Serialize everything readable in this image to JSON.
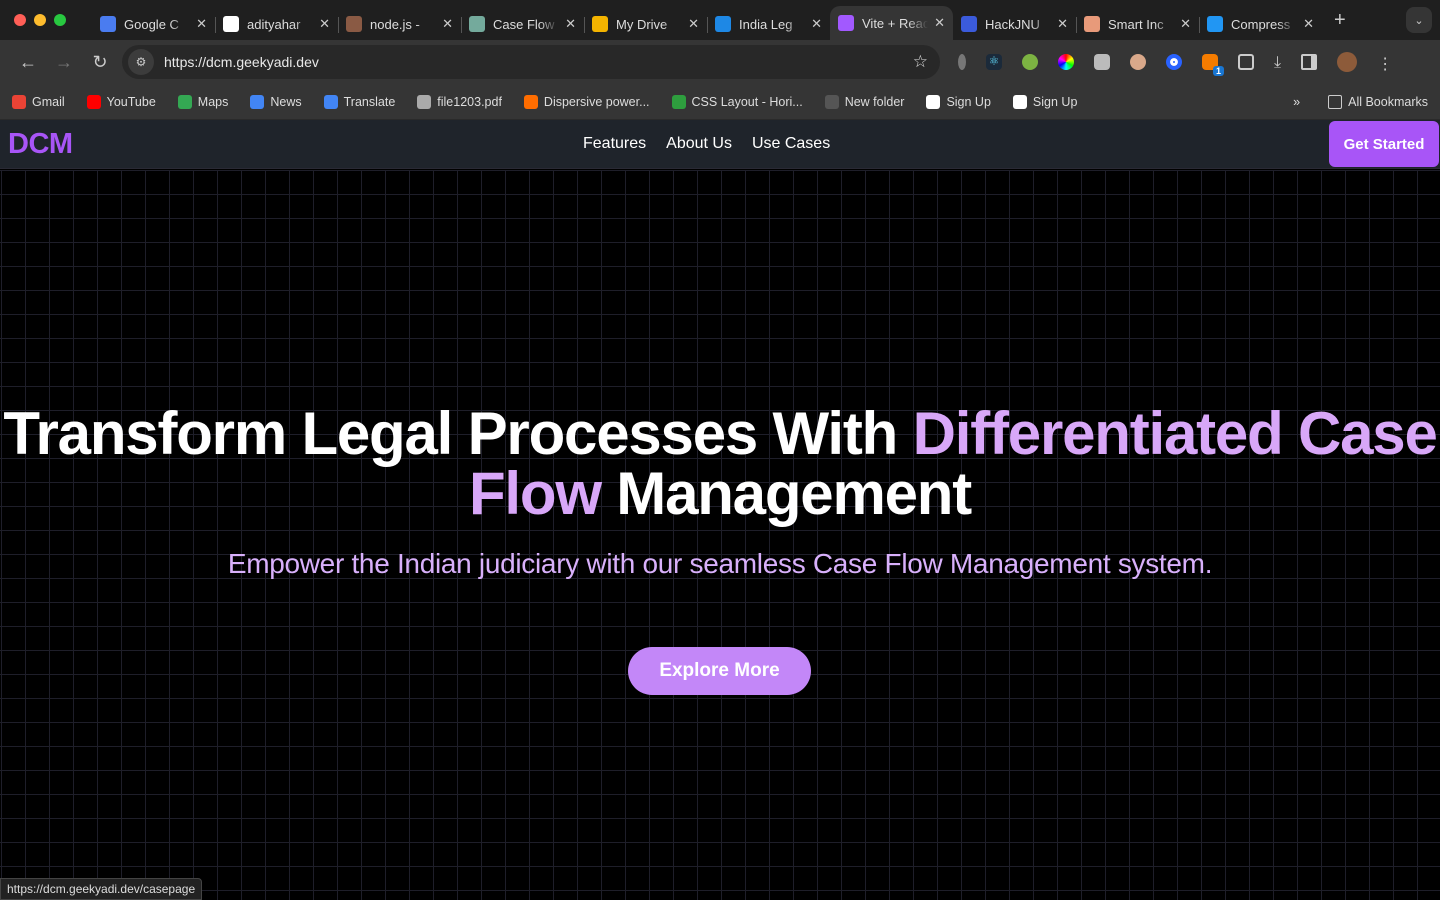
{
  "browser": {
    "tabs": [
      {
        "title": "Google C",
        "icon": "chrome-icon",
        "color": "#4a7cf0"
      },
      {
        "title": "adityahar",
        "icon": "github-icon",
        "color": "#ffffff"
      },
      {
        "title": "node.js -",
        "icon": "node-icon",
        "color": "#8a5a44"
      },
      {
        "title": "Case Flow",
        "icon": "chatgpt-icon",
        "color": "#74aa9c"
      },
      {
        "title": "My Drive",
        "icon": "drive-icon",
        "color": "#f4b400"
      },
      {
        "title": "India Leg",
        "icon": "k-icon",
        "color": "#1e88e5"
      },
      {
        "title": "Vite + React",
        "icon": "vite-icon",
        "color": "#a259ff",
        "active": true
      },
      {
        "title": "HackJNU",
        "icon": "docs-icon",
        "color": "#3b5bdb"
      },
      {
        "title": "Smart Inc",
        "icon": "bulb-icon",
        "color": "#e89a7a"
      },
      {
        "title": "Compress",
        "icon": "file-icon",
        "color": "#2196f3"
      }
    ],
    "url": "https://dcm.geekyadi.dev",
    "extension_badge": "1",
    "bookmarks": [
      {
        "label": "Gmail",
        "color": "#ea4335"
      },
      {
        "label": "YouTube",
        "color": "#ff0000"
      },
      {
        "label": "Maps",
        "color": "#34a853"
      },
      {
        "label": "News",
        "color": "#4285f4"
      },
      {
        "label": "Translate",
        "color": "#4285f4"
      },
      {
        "label": "file1203.pdf",
        "color": "#aaaaaa"
      },
      {
        "label": "Dispersive power...",
        "color": "#ff6d00"
      },
      {
        "label": "CSS Layout - Hori...",
        "color": "#2e9e3e"
      },
      {
        "label": "New folder",
        "color": "#555555"
      },
      {
        "label": "Sign Up",
        "color": "#ffffff"
      },
      {
        "label": "Sign Up",
        "color": "#ffffff"
      }
    ],
    "all_bookmarks": "All Bookmarks",
    "status_url": "https://dcm.geekyadi.dev/casepage"
  },
  "site": {
    "logo": "DCM",
    "nav": [
      "Features",
      "About Us",
      "Use Cases"
    ],
    "cta": "Get Started",
    "hero": {
      "title_part1": "Transform Legal Processes With ",
      "title_highlight1": "Differentiated Case",
      "title_highlight2": "Flow",
      "title_part2": " Management",
      "subtitle": "Empower the Indian judiciary with our seamless Case Flow Management system.",
      "button": "Explore More"
    },
    "colors": {
      "accent": "#a855f7",
      "highlight": "#d8a7f8",
      "button": "#c387f8"
    }
  }
}
